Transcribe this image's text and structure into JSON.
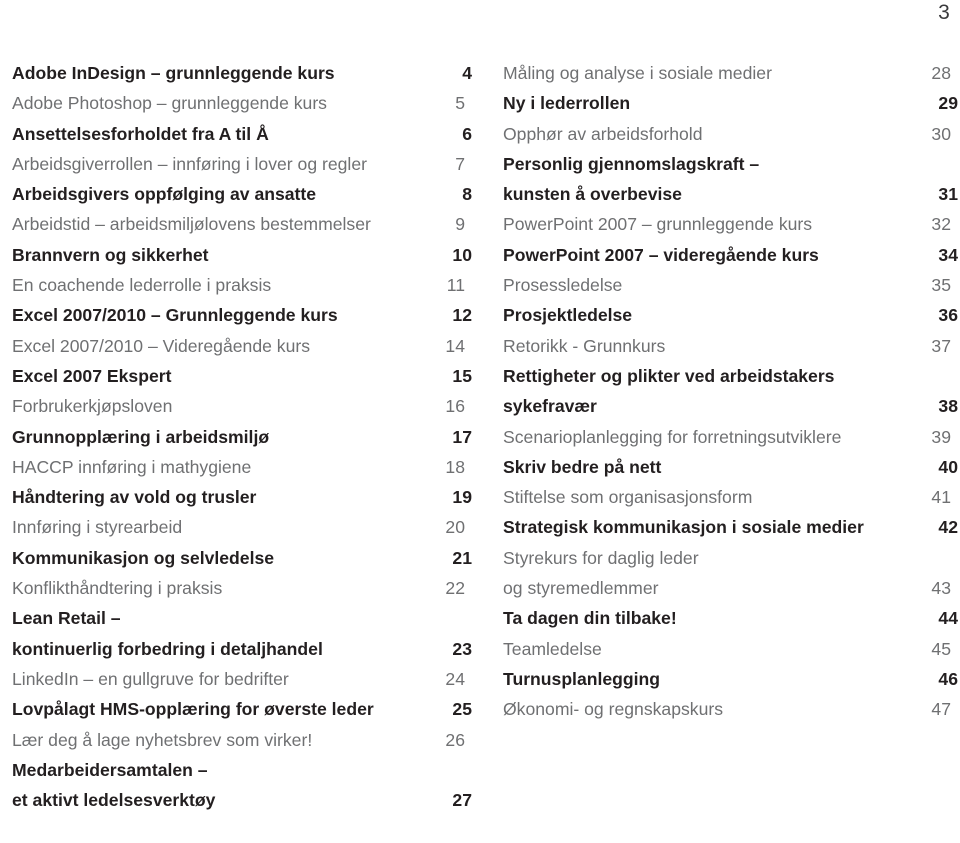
{
  "page": {
    "folio": "3",
    "background_color": "#ffffff",
    "bold_color": "#231f20",
    "regular_color": "#6f7072"
  },
  "toc": {
    "left_column": [
      {
        "title": "Adobe InDesign – grunnleggende kurs",
        "page": "4",
        "style": "bold",
        "leader": true
      },
      {
        "title": "Adobe Photoshop – grunnleggende kurs",
        "page": "5",
        "style": "regular",
        "leader": true
      },
      {
        "title": "Ansettelsesforholdet fra A til Å",
        "page": "6",
        "style": "bold",
        "leader": true
      },
      {
        "title": "Arbeidsgiverrollen – innføring i lover og regler",
        "page": "7",
        "style": "regular",
        "leader": true
      },
      {
        "title": "Arbeidsgivers oppfølging av ansatte",
        "page": "8",
        "style": "bold",
        "leader": true
      },
      {
        "title": "Arbeidstid – arbeidsmiljølovens bestemmelser",
        "page": "9",
        "style": "regular",
        "leader": true
      },
      {
        "title": "Brannvern og sikkerhet",
        "page": "10",
        "style": "bold",
        "leader": true
      },
      {
        "title": "En coachende lederrolle i praksis",
        "page": "11",
        "style": "regular",
        "leader": true
      },
      {
        "title": "Excel 2007/2010 – Grunnleggende kurs",
        "page": "12",
        "style": "bold",
        "leader": true
      },
      {
        "title": "Excel 2007/2010 – Videregående kurs",
        "page": "14",
        "style": "regular",
        "leader": true
      },
      {
        "title": "Excel 2007 Ekspert",
        "page": "15",
        "style": "bold",
        "leader": true
      },
      {
        "title": "Forbrukerkjøpsloven",
        "page": "16",
        "style": "regular",
        "leader": true
      },
      {
        "title": "Grunnopplæring i arbeidsmiljø",
        "page": "17",
        "style": "bold",
        "leader": true
      },
      {
        "title": "HACCP innføring i mathygiene",
        "page": "18",
        "style": "regular",
        "leader": true
      },
      {
        "title": "Håndtering av vold og trusler",
        "page": "19",
        "style": "bold",
        "leader": true
      },
      {
        "title": "Innføring i styrearbeid",
        "page": "20",
        "style": "regular",
        "leader": true
      },
      {
        "title": "Kommunikasjon og selvledelse",
        "page": "21",
        "style": "bold",
        "leader": true
      },
      {
        "title": "Konflikthåndtering i praksis",
        "page": "22",
        "style": "regular",
        "leader": true
      },
      {
        "title": "Lean Retail –",
        "page": "",
        "style": "bold",
        "leader": false
      },
      {
        "title": "kontinuerlig forbedring i detaljhandel",
        "page": "23",
        "style": "bold",
        "leader": true
      },
      {
        "title": "LinkedIn – en gullgruve for bedrifter",
        "page": "24",
        "style": "regular",
        "leader": true
      },
      {
        "title": "Lovpålagt HMS-opplæring for øverste leder",
        "page": "25",
        "style": "bold",
        "leader": true
      },
      {
        "title": "Lær deg å lage nyhetsbrev som virker!",
        "page": "26",
        "style": "regular",
        "leader": true
      },
      {
        "title": "Medarbeidersamtalen –",
        "page": "",
        "style": "bold",
        "leader": false
      },
      {
        "title": "et aktivt ledelsesverktøy",
        "page": "27",
        "style": "bold",
        "leader": true
      }
    ],
    "right_column": [
      {
        "title": "Måling og analyse i sosiale medier",
        "page": "28",
        "style": "regular",
        "leader": true
      },
      {
        "title": "Ny i lederrollen",
        "page": "29",
        "style": "bold",
        "leader": true
      },
      {
        "title": "Opphør av arbeidsforhold",
        "page": "30",
        "style": "regular",
        "leader": true
      },
      {
        "title": "Personlig gjennomslagskraft –",
        "page": "",
        "style": "bold",
        "leader": false
      },
      {
        "title": "kunsten å overbevise",
        "page": "31",
        "style": "bold",
        "leader": true
      },
      {
        "title": "PowerPoint 2007 – grunnleggende kurs",
        "page": "32",
        "style": "regular",
        "leader": true
      },
      {
        "title": "PowerPoint 2007 – videregående kurs",
        "page": "34",
        "style": "bold",
        "leader": true
      },
      {
        "title": "Prosessledelse",
        "page": "35",
        "style": "regular",
        "leader": true
      },
      {
        "title": "Prosjektledelse",
        "page": "36",
        "style": "bold",
        "leader": true
      },
      {
        "title": "Retorikk - Grunnkurs",
        "page": "37",
        "style": "regular",
        "leader": true
      },
      {
        "title": "Rettigheter og plikter ved arbeidstakers",
        "page": "",
        "style": "bold",
        "leader": false
      },
      {
        "title": "sykefravær",
        "page": "38",
        "style": "bold",
        "leader": true
      },
      {
        "title": "Scenarioplanlegging for forretningsutviklere",
        "page": "39",
        "style": "regular",
        "leader": true
      },
      {
        "title": "Skriv bedre på nett",
        "page": "40",
        "style": "bold",
        "leader": true
      },
      {
        "title": "Stiftelse som organisasjonsform",
        "page": "41",
        "style": "regular",
        "leader": true
      },
      {
        "title": "Strategisk kommunikasjon i sosiale medier",
        "page": "42",
        "style": "bold",
        "leader": true
      },
      {
        "title": "Styrekurs for daglig leder",
        "page": "",
        "style": "regular",
        "leader": false
      },
      {
        "title": "og styremedlemmer",
        "page": "43",
        "style": "regular",
        "leader": true
      },
      {
        "title": "Ta dagen din tilbake!",
        "page": "44",
        "style": "bold",
        "leader": true
      },
      {
        "title": "Teamledelse",
        "page": "45",
        "style": "regular",
        "leader": true
      },
      {
        "title": "Turnusplanlegging",
        "page": "46",
        "style": "bold",
        "leader": true
      },
      {
        "title": "Økonomi- og regnskapskurs",
        "page": "47",
        "style": "regular",
        "leader": true
      }
    ]
  }
}
